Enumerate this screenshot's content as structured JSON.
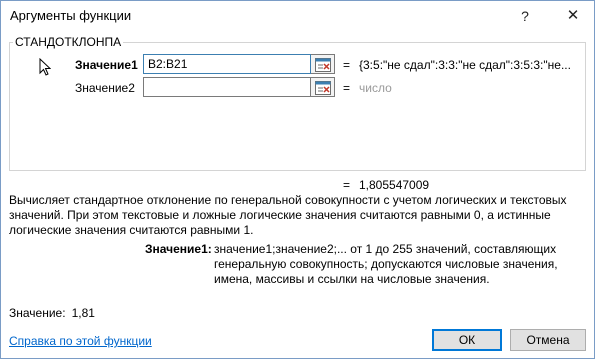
{
  "window": {
    "title": "Аргументы функции",
    "help_glyph": "?",
    "close_glyph": "✕"
  },
  "group": {
    "function_name": "СТАНДОТКЛОНПА"
  },
  "arguments": [
    {
      "label": "Значение1",
      "input_value": "B2:B21",
      "equals": "=",
      "preview": "{3:5:\"не сдал\":3:3:\"не сдал\":3:5:3:\"не..."
    },
    {
      "label": "Значение2",
      "input_value": "",
      "equals": "=",
      "preview": "число"
    }
  ],
  "result": {
    "equals": "=",
    "value": "1,805547009"
  },
  "description": "Вычисляет стандартное отклонение по генеральной совокупности с учетом логических и текстовых значений. При этом текстовые и ложные логические значения считаются равными 0, а истинные логические значения считаются равными 1.",
  "parameter_help": {
    "name": "Значение1:",
    "text": "значение1;значение2;... от 1 до 255 значений, составляющих генеральную совокупность; допускаются числовые значения, имена, массивы и ссылки на числовые значения."
  },
  "value_line": {
    "label": "Значение:",
    "value": "1,81"
  },
  "help_link": "Справка по этой функции",
  "buttons": {
    "ok": "ОК",
    "cancel": "Отмена"
  },
  "icons": {
    "ref_button": "collapse-dialog-icon",
    "cursor": "mouse-pointer-icon"
  },
  "colors": {
    "link": "#0066cc",
    "default_button_border": "#0078d7",
    "disabled_text": "#9a9a9a"
  }
}
